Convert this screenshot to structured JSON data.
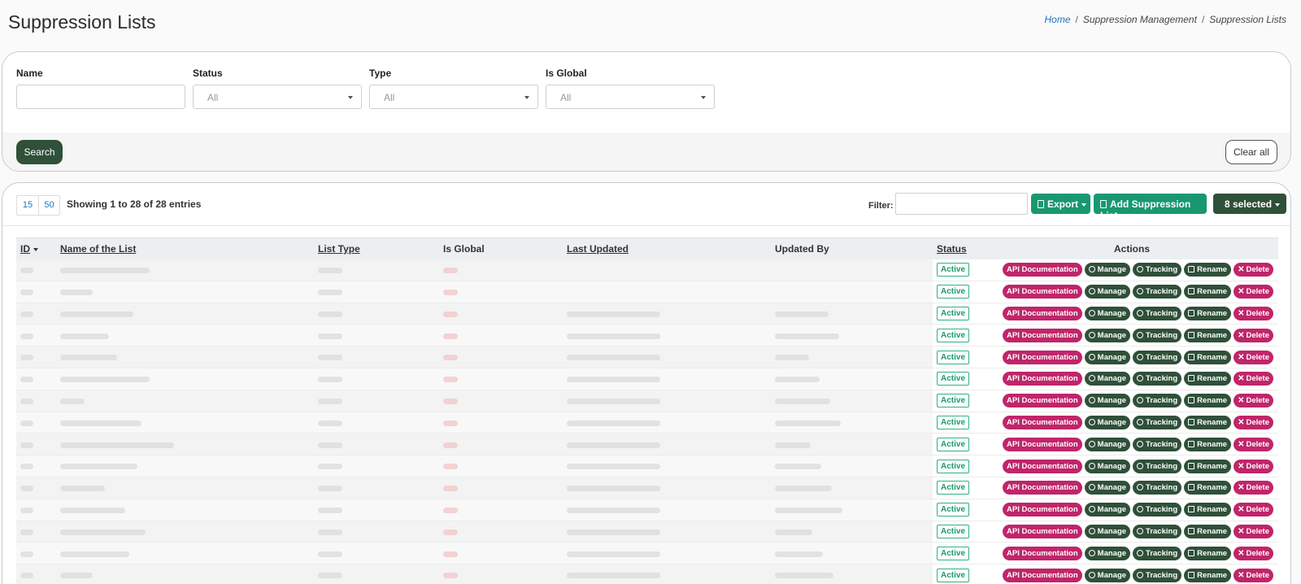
{
  "page": {
    "title": "Suppression Lists"
  },
  "breadcrumb": {
    "home": "Home",
    "section": "Suppression Management",
    "current": "Suppression Lists"
  },
  "filters": {
    "name_label": "Name",
    "status_label": "Status",
    "status_value": "All",
    "type_label": "Type",
    "type_value": "All",
    "global_label": "Is Global",
    "global_value": "All",
    "search_button": "Search",
    "clear_button": "Clear all"
  },
  "table_controls": {
    "page_sizes": [
      "15",
      "50"
    ],
    "showing": "Showing 1 to 28 of 28 entries",
    "filter_label": "Filter:",
    "export_button": "Export",
    "add_button": "Add Suppression List",
    "selected_button": "8 selected"
  },
  "table": {
    "columns": {
      "id": "ID",
      "name": "Name of the List",
      "type": "List Type",
      "global": "Is Global",
      "updated": "Last Updated",
      "by": "Updated By",
      "status": "Status",
      "actions": "Actions"
    },
    "status_active": "Active",
    "actions": {
      "api": "API Documentation",
      "manage": "Manage",
      "tracking": "Tracking",
      "rename": "Rename",
      "delete": "Delete"
    }
  },
  "colors": {
    "primary_dark": "#2f5039",
    "accent_green": "#199870",
    "accent_pink": "#c0256a",
    "link_blue": "#1e73be"
  }
}
